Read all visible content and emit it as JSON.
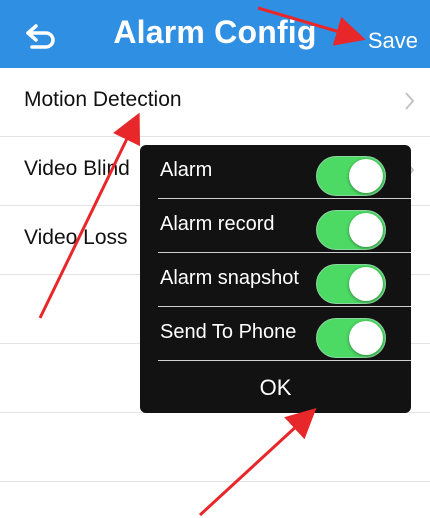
{
  "header": {
    "title": "Alarm Config",
    "save_label": "Save",
    "back_icon": "back-arrow-icon",
    "color": "#2f8fe2"
  },
  "list": {
    "items": [
      {
        "label": "Motion Detection"
      },
      {
        "label": "Video Blind"
      },
      {
        "label": "Video Loss"
      },
      {
        "label": ""
      },
      {
        "label": ""
      },
      {
        "label": ""
      }
    ],
    "chevron_icon": "chevron-right-icon"
  },
  "dialog": {
    "rows": [
      {
        "label": "Alarm",
        "on": true
      },
      {
        "label": "Alarm record",
        "on": true
      },
      {
        "label": "Alarm snapshot",
        "on": true
      },
      {
        "label": "Send To Phone",
        "on": true
      }
    ],
    "ok_label": "OK",
    "toggle_color": "#4cd964"
  },
  "annotations": {
    "arrow_color": "#e8272a"
  }
}
